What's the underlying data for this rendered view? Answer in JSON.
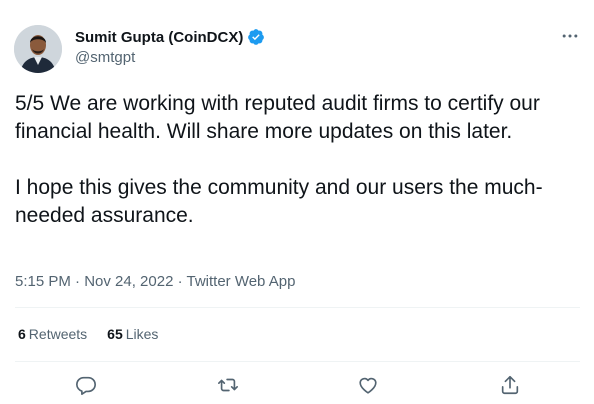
{
  "author": {
    "name": "Sumit Gupta (CoinDCX)",
    "handle": "@smtgpt"
  },
  "tweet": {
    "paragraphs": [
      "5/5 We are working with reputed audit firms to certify our financial health. Will share more updates on this later.",
      "I hope this gives the community and our users the much-needed assurance."
    ],
    "meta": "5:15 PM · Nov 24, 2022 · Twitter Web App"
  },
  "stats": {
    "retweets_count": "6",
    "retweets_label": "Retweets",
    "likes_count": "65",
    "likes_label": "Likes"
  },
  "icons": {
    "more": "more-options-icon",
    "verified": "verified-badge-icon",
    "reply": "reply-icon",
    "retweet": "retweet-icon",
    "like": "like-icon",
    "share": "share-icon"
  },
  "colors": {
    "verified_blue": "#1d9bf0",
    "secondary_text": "#536471",
    "primary_text": "#0f1419"
  }
}
